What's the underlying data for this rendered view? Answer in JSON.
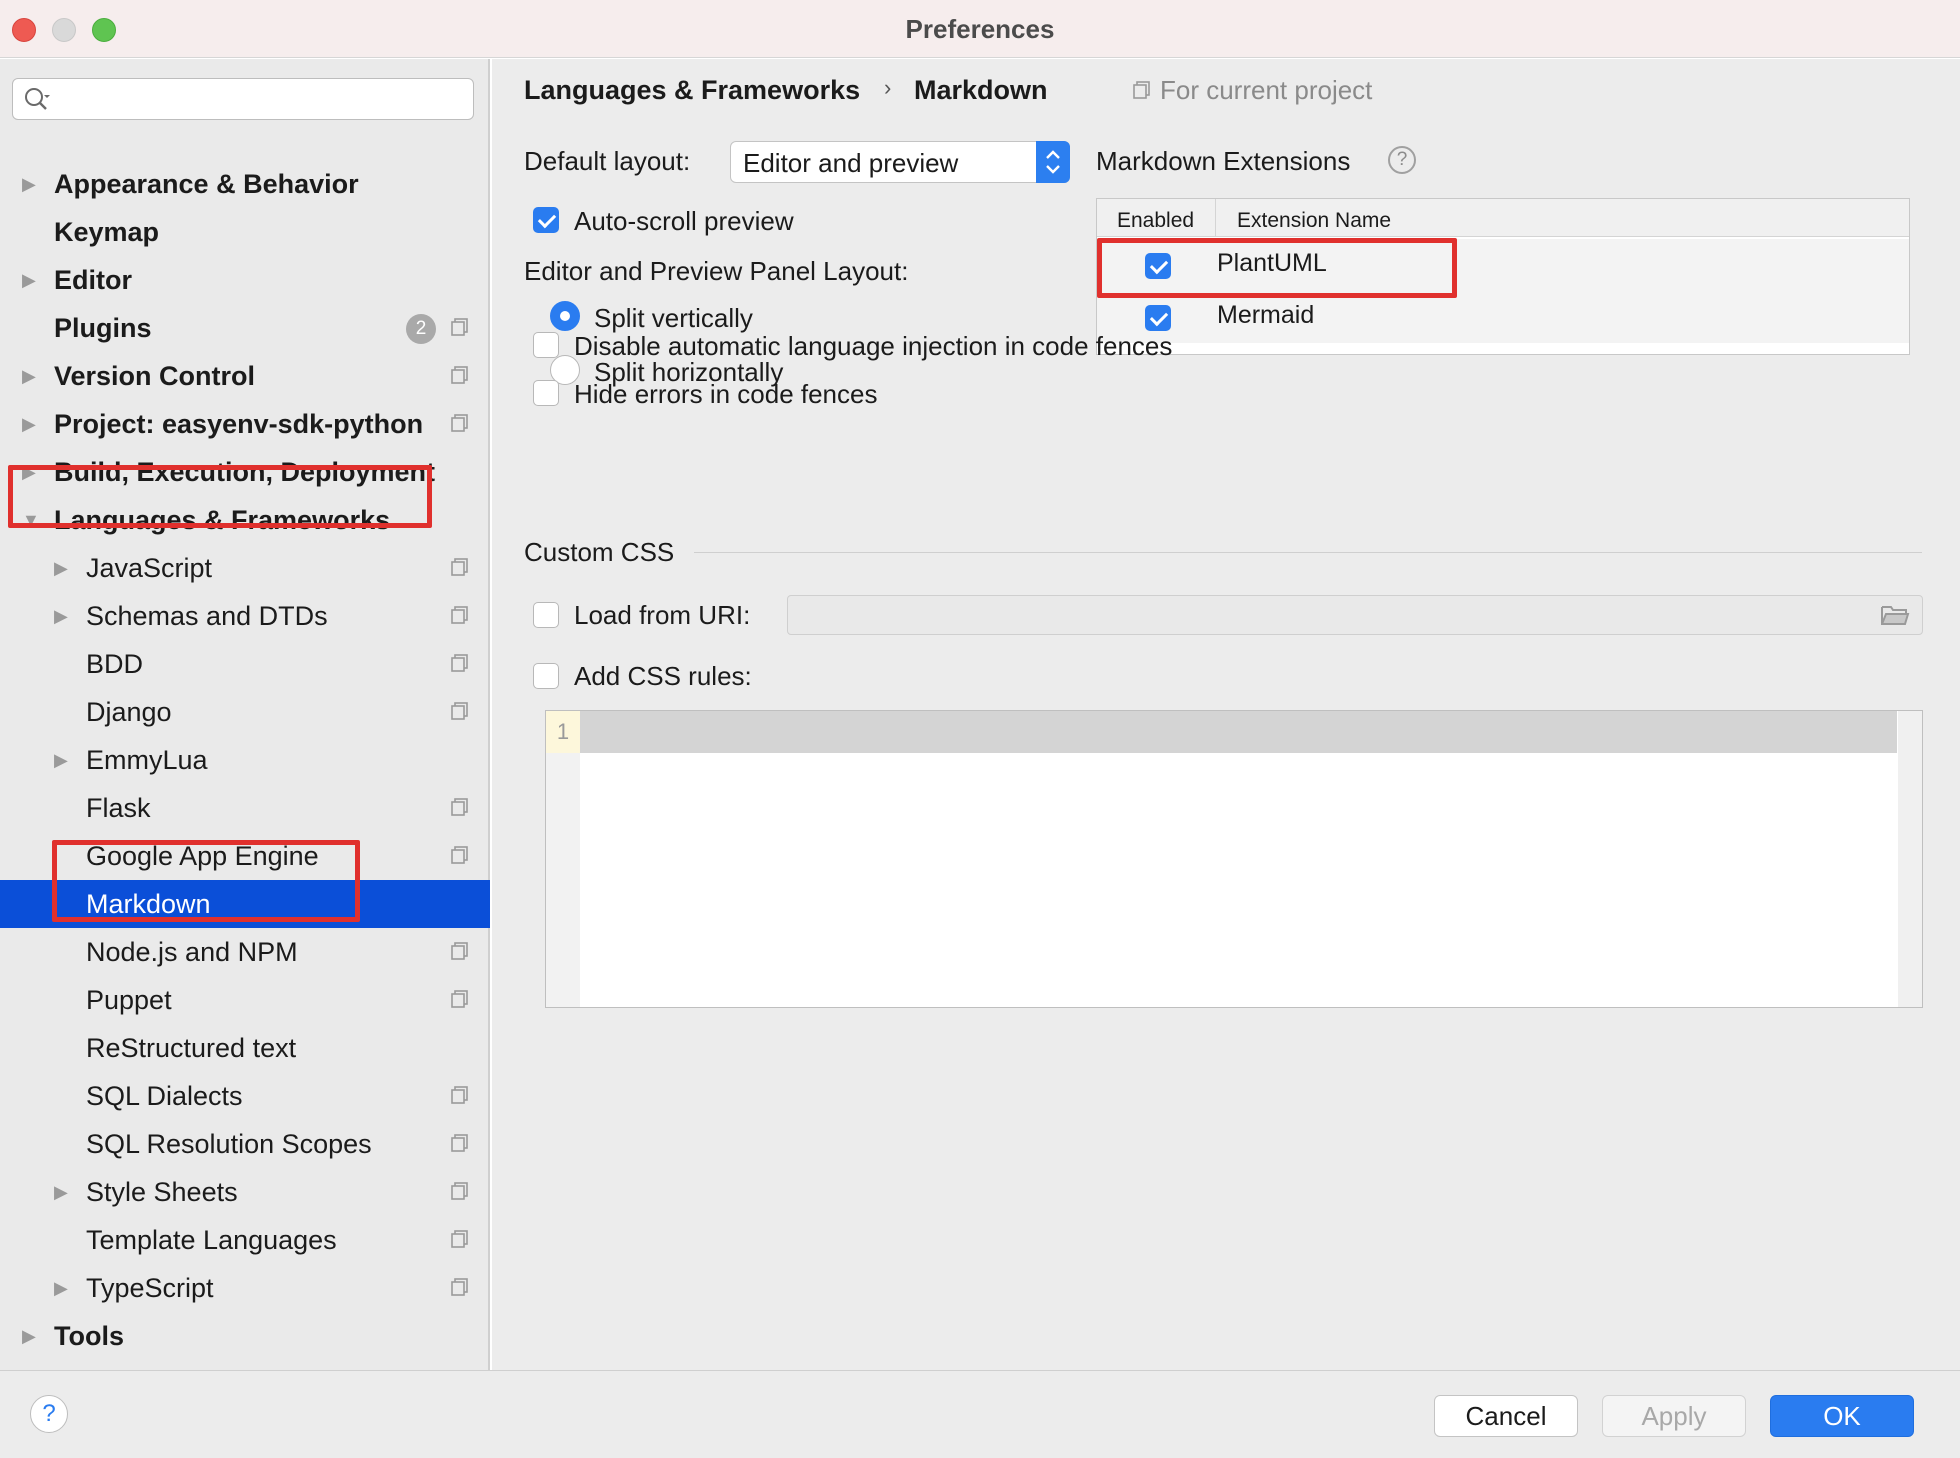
{
  "window": {
    "title": "Preferences"
  },
  "sidebar": {
    "search_value": "",
    "items": [
      {
        "label": "Appearance & Behavior"
      },
      {
        "label": "Keymap"
      },
      {
        "label": "Editor"
      },
      {
        "label": "Plugins",
        "badge": "2"
      },
      {
        "label": "Version Control"
      },
      {
        "label": "Project: easyenv-sdk-python"
      },
      {
        "label": "Build, Execution, Deployment"
      },
      {
        "label": "Languages & Frameworks"
      },
      {
        "label": "JavaScript"
      },
      {
        "label": "Schemas and DTDs"
      },
      {
        "label": "BDD"
      },
      {
        "label": "Django"
      },
      {
        "label": "EmmyLua"
      },
      {
        "label": "Flask"
      },
      {
        "label": "Google App Engine"
      },
      {
        "label": "Markdown"
      },
      {
        "label": "Node.js and NPM"
      },
      {
        "label": "Puppet"
      },
      {
        "label": "ReStructured text"
      },
      {
        "label": "SQL Dialects"
      },
      {
        "label": "SQL Resolution Scopes"
      },
      {
        "label": "Style Sheets"
      },
      {
        "label": "Template Languages"
      },
      {
        "label": "TypeScript"
      },
      {
        "label": "Tools"
      }
    ]
  },
  "header": {
    "breadcrumb_parent": "Languages & Frameworks",
    "breadcrumb_sep": "›",
    "breadcrumb_current": "Markdown",
    "scope_note": "For current project"
  },
  "settings": {
    "default_layout_label": "Default layout:",
    "default_layout_value": "Editor and preview",
    "auto_scroll_label": "Auto-scroll preview",
    "panel_layout_label": "Editor and Preview Panel Layout:",
    "split_vertically_label": "Split vertically",
    "split_horizontally_label": "Split horizontally",
    "disable_injection_label": "Disable automatic language injection in code fences",
    "hide_errors_label": "Hide errors in code fences"
  },
  "extensions": {
    "title": "Markdown Extensions",
    "help": "?",
    "col_enabled": "Enabled",
    "col_name": "Extension Name",
    "rows": [
      {
        "name": "PlantUML",
        "enabled": true
      },
      {
        "name": "Mermaid",
        "enabled": true
      }
    ]
  },
  "custom_css": {
    "section_title": "Custom CSS",
    "load_uri_label": "Load from URI:",
    "add_rules_label": "Add CSS rules:",
    "line_number": "1"
  },
  "footer": {
    "help": "?",
    "cancel": "Cancel",
    "apply": "Apply",
    "ok": "OK"
  },
  "colors": {
    "accent": "#2a7cf0",
    "selection": "#0b4fd8",
    "highlight_annotation": "#e0302d"
  }
}
